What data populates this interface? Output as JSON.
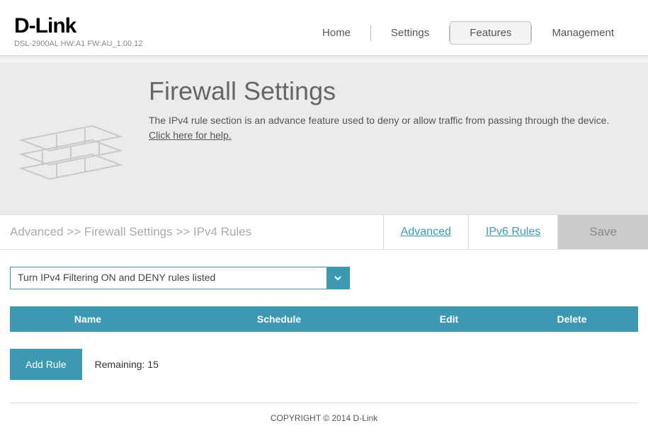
{
  "header": {
    "logo": "D-Link",
    "device_info": "DSL-2900AL   HW:A1   FW:AU_1.00.12",
    "nav": {
      "home": "Home",
      "settings": "Settings",
      "features": "Features",
      "management": "Management"
    }
  },
  "hero": {
    "title": "Firewall Settings",
    "desc": "The IPv4 rule section is an advance feature used to deny or allow traffic from passing through the device.",
    "help": "Click here for help."
  },
  "breadcrumb": "Advanced >> Firewall Settings >> IPv4 Rules",
  "tabs": {
    "advanced": "Advanced",
    "ipv6": "IPv6 Rules",
    "save": "Save"
  },
  "dropdown": {
    "selected": "Turn IPv4 Filtering ON and DENY rules listed"
  },
  "table": {
    "cols": {
      "name": "Name",
      "schedule": "Schedule",
      "edit": "Edit",
      "delete": "Delete"
    }
  },
  "actions": {
    "add_rule": "Add Rule",
    "remaining": "Remaining: 15"
  },
  "footer": {
    "copyright": "COPYRIGHT © 2014 D-Link"
  }
}
